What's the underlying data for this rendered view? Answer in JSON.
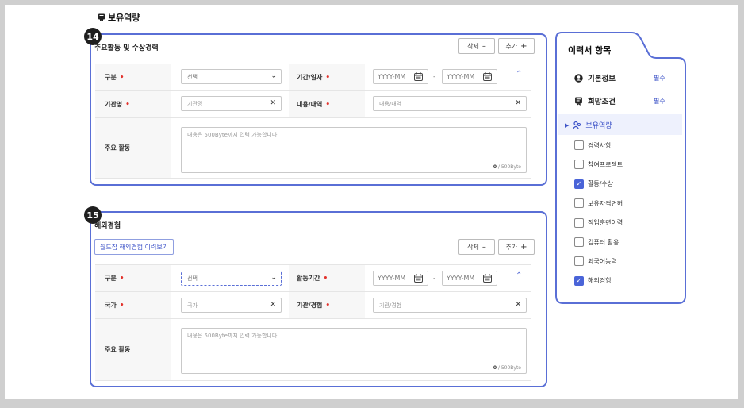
{
  "section": {
    "title": "보유역량",
    "icon": "bookmark-icon"
  },
  "card14": {
    "badge": "14",
    "title": "주요활동 및 수상경력",
    "delete_label": "삭제",
    "delete_symbol": "–",
    "add_label": "추가",
    "add_symbol": "+",
    "labels": {
      "category": "구분",
      "period": "기간/일자",
      "org": "기관명",
      "content": "내용/내역",
      "activity": "주요 활동"
    },
    "required_mark": "•",
    "select_value": "선택",
    "date_start": "YYYY-MM",
    "date_end": "YYYY-MM",
    "date_sep": "-",
    "org_placeholder": "기관명",
    "content_placeholder": "내용/내역",
    "textarea_placeholder": "내용은 500Byte까지 입력 가능합니다.",
    "count_current": "0",
    "count_max": " / 500Byte"
  },
  "card15": {
    "badge": "15",
    "title": "해외경험",
    "link_label": "월드잡 해외경험 이력보기",
    "delete_label": "삭제",
    "delete_symbol": "–",
    "add_label": "추가",
    "add_symbol": "+",
    "labels": {
      "category": "구분",
      "period": "활동기간",
      "country": "국가",
      "org": "기관/경험",
      "activity": "주요 활동"
    },
    "required_mark": "•",
    "select_value": "선택",
    "date_start": "YYYY-MM",
    "date_end": "YYYY-MM",
    "date_sep": "-",
    "country_placeholder": "국가",
    "org_placeholder": "기관/경험",
    "textarea_placeholder": "내용은 500Byte까지 입력 가능합니다.",
    "count_current": "0",
    "count_max": " / 500Byte"
  },
  "sidebar": {
    "title": "이력서 항목",
    "required_label": "필수",
    "items": [
      {
        "label": "기본정보",
        "icon": "user-circle-icon",
        "required": true
      },
      {
        "label": "희망조건",
        "icon": "bookmark-icon",
        "required": true
      },
      {
        "label": "보유역량",
        "icon": "people-icon",
        "active": true
      }
    ],
    "checks": [
      {
        "label": "경력사항",
        "checked": false
      },
      {
        "label": "참여프로젝트",
        "checked": false
      },
      {
        "label": "활동/수상",
        "checked": true
      },
      {
        "label": "보유자격면허",
        "checked": false
      },
      {
        "label": "직업훈련이력",
        "checked": false
      },
      {
        "label": "컴퓨터 활용",
        "checked": false
      },
      {
        "label": "외국어능력",
        "checked": false
      },
      {
        "label": "해외경험",
        "checked": true
      }
    ],
    "accent_color": "#5a6fd6",
    "check_color": "#4a64d8"
  }
}
